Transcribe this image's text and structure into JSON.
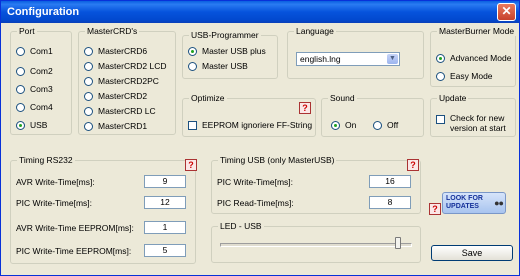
{
  "window": {
    "title": "Configuration",
    "close_glyph": "✕"
  },
  "port": {
    "label": "Port",
    "options": [
      "Com1",
      "Com2",
      "Com3",
      "Com4",
      "USB"
    ],
    "selected": "USB"
  },
  "mastercrds": {
    "label": "MasterCRD's",
    "options": [
      "MasterCRD6",
      "MasterCRD2 LCD",
      "MasterCRD2PC",
      "MasterCRD2",
      "MasterCRD LC",
      "MasterCRD1"
    ],
    "selected": null
  },
  "usb_programmer": {
    "label": "USB-Programmer",
    "options": [
      "Master USB plus",
      "Master USB"
    ],
    "selected": "Master USB plus"
  },
  "language": {
    "label": "Language",
    "value": "english.lng"
  },
  "masterburner_mode": {
    "label": "MasterBurner Mode",
    "options": [
      "Advanced Mode",
      "Easy Mode"
    ],
    "selected": "Advanced Mode"
  },
  "optimize": {
    "label": "Optimize",
    "checkbox_label": "EEPROM ignoriere FF-String",
    "checked": false
  },
  "sound": {
    "label": "Sound",
    "options": [
      "On",
      "Off"
    ],
    "selected": "On"
  },
  "update": {
    "label": "Update",
    "checkbox_label_line1": "Check for new",
    "checkbox_label_line2": "version at start",
    "checked": false
  },
  "timing_rs232": {
    "label": "Timing RS232",
    "fields": [
      {
        "label": "AVR Write-Time[ms]:",
        "value": "9"
      },
      {
        "label": "PIC Write-Time[ms]:",
        "value": "12"
      },
      {
        "label": "AVR Write-Time EEPROM[ms]:",
        "value": "1"
      },
      {
        "label": "PIC Write-Time EEPROM[ms]:",
        "value": "5"
      }
    ]
  },
  "timing_usb": {
    "label": "Timing USB (only MasterUSB)",
    "fields": [
      {
        "label": "PIC Write-Time[ms]:",
        "value": "16"
      },
      {
        "label": "PIC Read-Time[ms]:",
        "value": "8"
      }
    ]
  },
  "led_usb": {
    "label": "LED - USB",
    "level": 0.94
  },
  "look_for_updates": {
    "line1": "LOOK FOR",
    "line2": "UPDATES",
    "icon": "binoculars-icon"
  },
  "help_glyph": "?",
  "save_label": "Save",
  "colors": {
    "titlebar": "#0653dc",
    "radio_dot": "#21a121",
    "help_red": "#cc0000"
  }
}
